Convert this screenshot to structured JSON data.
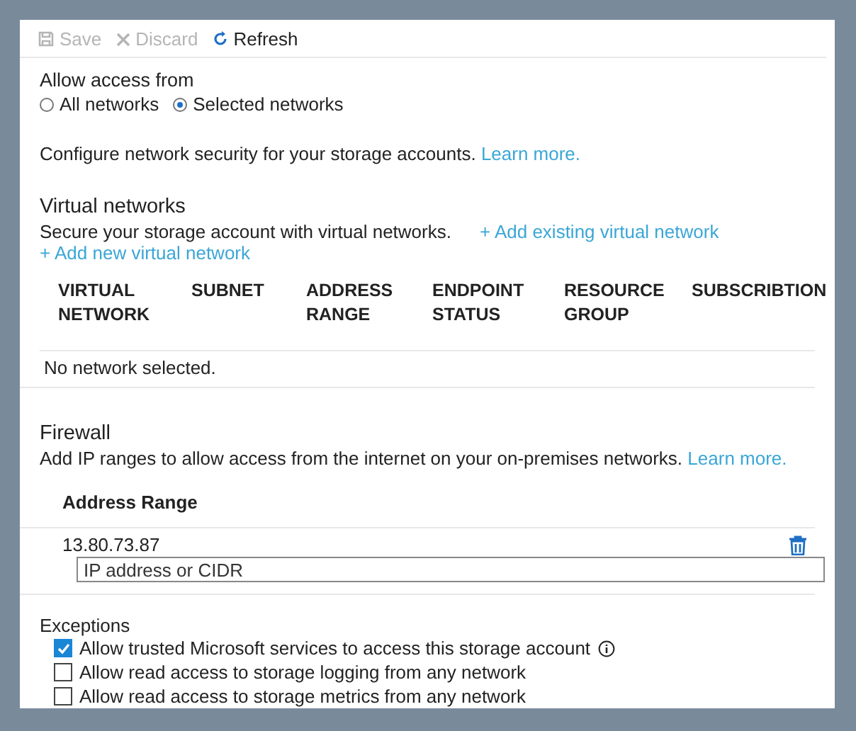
{
  "toolbar": [
    {
      "kind": "save",
      "label": "Save",
      "disabled": true
    },
    {
      "kind": "discard",
      "label": "Discard",
      "disabled": true
    },
    {
      "kind": "refresh",
      "label": "Refresh",
      "disabled": false
    }
  ],
  "access": {
    "label": "Allow access from",
    "options": [
      {
        "label": "All networks",
        "selected": false
      },
      {
        "label": "Selected networks",
        "selected": true
      }
    ]
  },
  "intro": {
    "text": "Configure network security for your storage accounts.",
    "link": "Learn more."
  },
  "virtual_networks": {
    "title": "Virtual networks",
    "description": "Secure your storage account with virtual networks.",
    "add_existing": "+ Add existing virtual network",
    "add_new": "+ Add new virtual network",
    "columns": [
      "VIRTUAL NETWORK",
      "SUBNET",
      "ADDRESS RANGE",
      "ENDPOINT STATUS",
      "RESOURCE GROUP",
      "SUBSCRIBTION"
    ],
    "empty": "No network selected."
  },
  "firewall": {
    "title": "Firewall",
    "description": "Add IP ranges to allow access from the internet on your on-premises networks.",
    "link": "Learn more.",
    "column": "Address Range",
    "rows": [
      "13.80.73.87"
    ],
    "placeholder": "IP address or CIDR"
  },
  "exceptions": {
    "title": "Exceptions",
    "items": [
      {
        "label": "Allow trusted Microsoft services to access this storage account",
        "checked": true,
        "info": true
      },
      {
        "label": "Allow read access to storage logging from any network",
        "checked": false,
        "info": false
      },
      {
        "label": "Allow read access to storage metrics from any network",
        "checked": false,
        "info": false
      }
    ]
  }
}
